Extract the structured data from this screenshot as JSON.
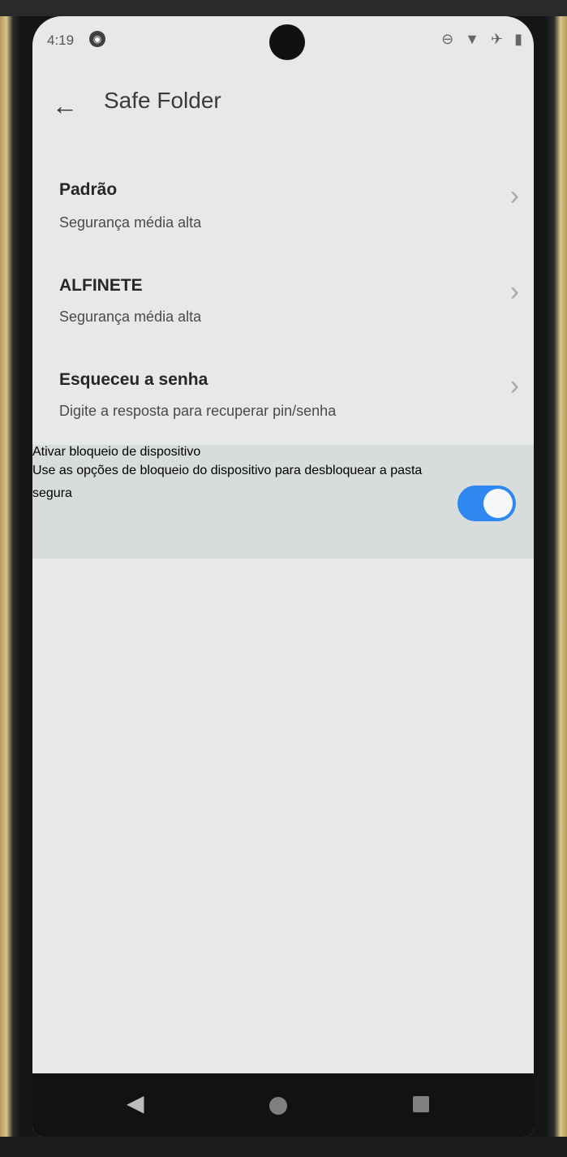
{
  "status_bar": {
    "time": "4:19",
    "icons": [
      "do-not-disturb-icon",
      "wifi-icon",
      "airplane-icon",
      "battery-icon"
    ]
  },
  "header": {
    "title": "Safe Folder",
    "back_icon": "arrow-left-icon"
  },
  "items": [
    {
      "title": "Padrão",
      "subtitle": "Segurança média alta",
      "chevron": "chevron-right-icon"
    },
    {
      "title": "ALFINETE",
      "subtitle": "Segurança média alta",
      "chevron": "chevron-right-icon"
    },
    {
      "title": "Esqueceu a senha",
      "subtitle": "Digite a resposta para recuperar pin/senha",
      "chevron": "chevron-right-icon"
    }
  ],
  "device_lock": {
    "title": "Ativar bloqueio de dispositivo",
    "subtitle": "Use as opções de bloqueio do dispositivo para desbloquear a pasta segura",
    "enabled": true,
    "toggle_color": "#2f87f0"
  },
  "nav": {
    "back": "triangle-back-icon",
    "home": "circle-home-icon",
    "recents": "square-recents-icon"
  }
}
